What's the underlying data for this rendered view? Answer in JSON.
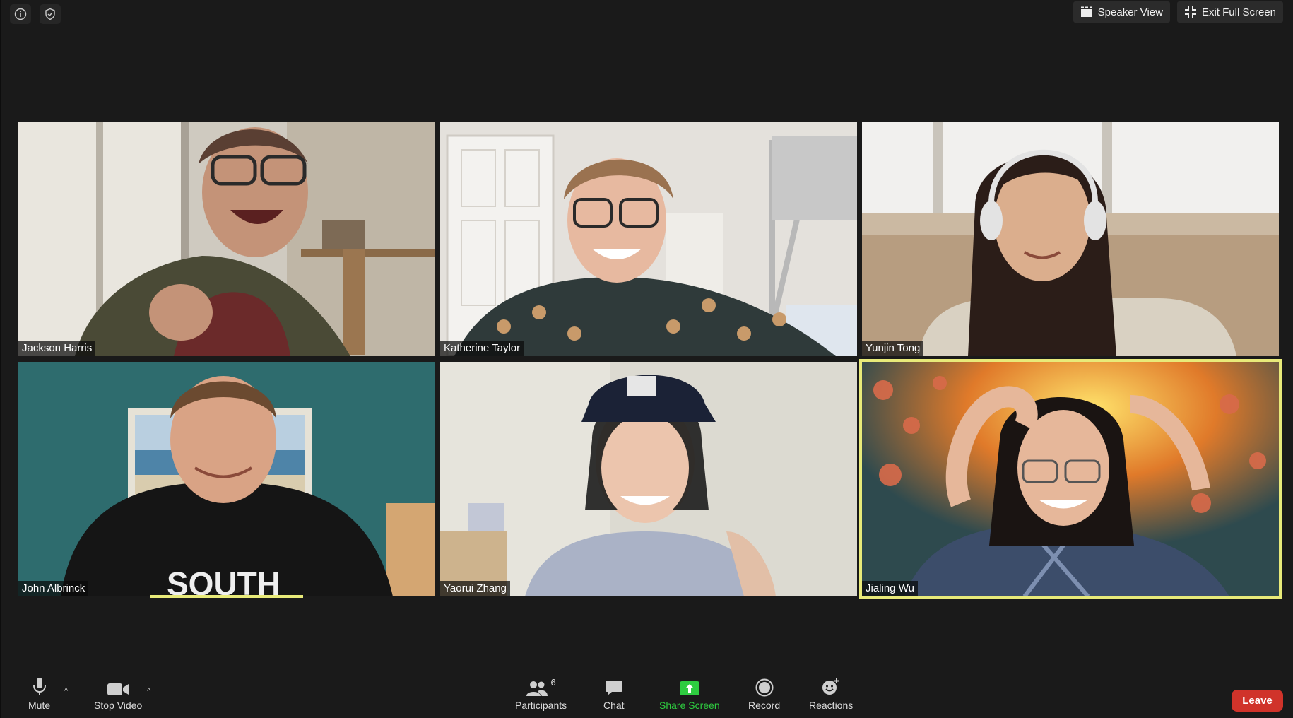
{
  "top_bar": {
    "speaker_view_label": "Speaker View",
    "exit_full_screen_label": "Exit Full Screen"
  },
  "participants": [
    {
      "name": "Jackson Harris",
      "active": false
    },
    {
      "name": "Katherine Taylor",
      "active": false
    },
    {
      "name": "Yunjin Tong",
      "active": false
    },
    {
      "name": "John Albrinck",
      "active": false
    },
    {
      "name": "Yaorui Zhang",
      "active": false
    },
    {
      "name": "Jialing Wu",
      "active": true
    }
  ],
  "toolbar": {
    "mute_label": "Mute",
    "stop_video_label": "Stop Video",
    "participants_label": "Participants",
    "participants_count": "6",
    "chat_label": "Chat",
    "share_screen_label": "Share Screen",
    "record_label": "Record",
    "reactions_label": "Reactions",
    "leave_label": "Leave"
  },
  "colors": {
    "active_speaker": "#e8ea79",
    "share_green": "#2ecc40",
    "leave_red": "#d0332a"
  }
}
